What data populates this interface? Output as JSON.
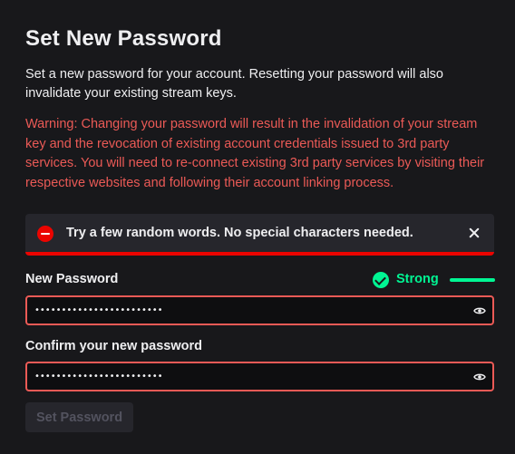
{
  "dialog": {
    "title": "Set New Password",
    "description": "Set a new password for your account. Resetting your password will also invalidate your existing stream keys.",
    "warning": "Warning: Changing your password will result in the invalidation of your stream key and the revocation of existing account credentials issued to 3rd party services. You will need to re-connect existing 3rd party services by visiting their respective websites and following their account linking process."
  },
  "toast": {
    "message": "Try a few random words. No special characters needed.",
    "icon": "error-icon",
    "close_icon": "close-icon",
    "accent_color": "#eb0400"
  },
  "new_password": {
    "label": "New Password",
    "value": "••••••••••••••••••••••••",
    "strength_label": "Strong",
    "strength_color": "#00f593",
    "strength_level": 1.0,
    "toggle_icon": "eye-icon"
  },
  "confirm_password": {
    "label": "Confirm your new password",
    "value": "••••••••••••••••••••••••",
    "toggle_icon": "eye-icon"
  },
  "submit": {
    "label": "Set Password",
    "enabled": false
  },
  "colors": {
    "warning_text": "#eb5a56",
    "input_border_error": "#eb5a56",
    "background": "#18181b"
  }
}
